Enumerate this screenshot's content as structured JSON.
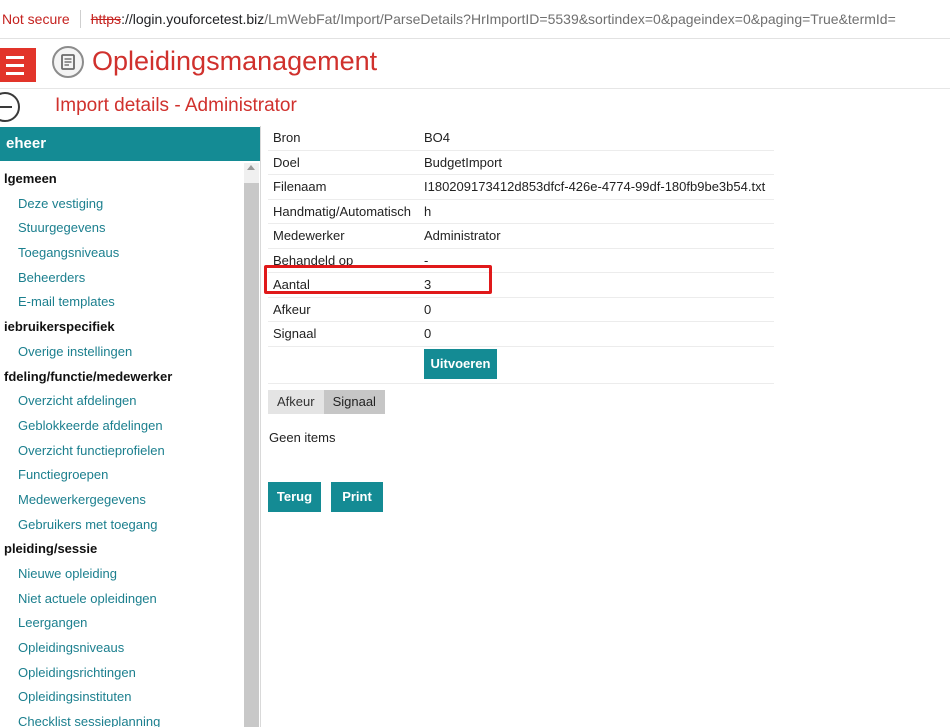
{
  "browser": {
    "not_secure": "Not secure",
    "url_scheme": "https",
    "url_host": "://login.youforcetest.biz",
    "url_path": "/LmWebFat/Import/ParseDetails?HrImportID=5539&sortindex=0&pageindex=0&paging=True&termId="
  },
  "app": {
    "title": "Opleidingsmanagement",
    "page_title": "Import details - Administrator"
  },
  "sidebar": {
    "header": "eheer",
    "items": [
      {
        "type": "section",
        "label": "lgemeen"
      },
      {
        "type": "link",
        "label": "Deze vestiging"
      },
      {
        "type": "link",
        "label": "Stuurgegevens"
      },
      {
        "type": "link",
        "label": "Toegangsniveaus"
      },
      {
        "type": "link",
        "label": "Beheerders"
      },
      {
        "type": "link",
        "label": "E-mail templates"
      },
      {
        "type": "section",
        "label": "iebruikerspecifiek"
      },
      {
        "type": "link",
        "label": "Overige instellingen"
      },
      {
        "type": "section",
        "label": "fdeling/functie/medewerker"
      },
      {
        "type": "link",
        "label": "Overzicht afdelingen"
      },
      {
        "type": "link",
        "label": "Geblokkeerde afdelingen"
      },
      {
        "type": "link",
        "label": "Overzicht functieprofielen"
      },
      {
        "type": "link",
        "label": "Functiegroepen"
      },
      {
        "type": "link",
        "label": "Medewerkergegevens"
      },
      {
        "type": "link",
        "label": "Gebruikers met toegang"
      },
      {
        "type": "section",
        "label": "pleiding/sessie"
      },
      {
        "type": "link",
        "label": "Nieuwe opleiding"
      },
      {
        "type": "link",
        "label": "Niet actuele opleidingen"
      },
      {
        "type": "link",
        "label": "Leergangen"
      },
      {
        "type": "link",
        "label": "Opleidingsniveaus"
      },
      {
        "type": "link",
        "label": "Opleidingsrichtingen"
      },
      {
        "type": "link",
        "label": "Opleidingsinstituten"
      },
      {
        "type": "link",
        "label": "Checklist sessieplanning"
      }
    ]
  },
  "details": [
    {
      "label": "Bron",
      "value": "BO4"
    },
    {
      "label": "Doel",
      "value": "BudgetImport"
    },
    {
      "label": "Filenaam",
      "value": "I180209173412d853dfcf-426e-4774-99df-180fb9be3b54.txt"
    },
    {
      "label": "Handmatig/Automatisch",
      "value": "h"
    },
    {
      "label": "Medewerker",
      "value": "Administrator"
    },
    {
      "label": "Behandeld op",
      "value": "-"
    },
    {
      "label": "Aantal",
      "value": "3"
    },
    {
      "label": "Afkeur",
      "value": "0"
    },
    {
      "label": "Signaal",
      "value": "0"
    }
  ],
  "buttons": {
    "execute": "Uitvoeren",
    "back": "Terug",
    "print": "Print"
  },
  "tabs": [
    {
      "label": "Afkeur",
      "active": false
    },
    {
      "label": "Signaal",
      "active": true
    }
  ],
  "empty_message": "Geen items",
  "colors": {
    "accent": "#148b94",
    "title_red": "#d0312d",
    "highlight": "#e0191a"
  }
}
